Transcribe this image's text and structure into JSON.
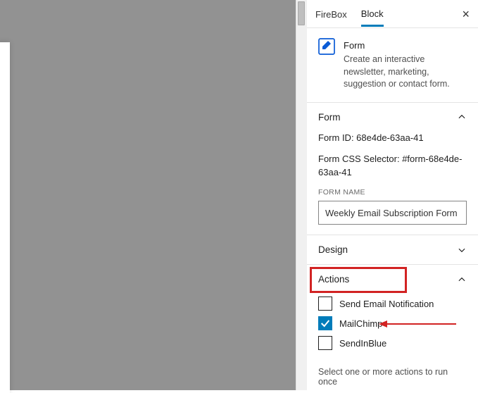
{
  "tabs": {
    "firebox": "FireBox",
    "block": "Block"
  },
  "block_card": {
    "title": "Form",
    "description": "Create an interactive newsletter, marketing, suggestion or contact form."
  },
  "form": {
    "header": "Form",
    "id_label": "Form ID: 68e4de-63aa-41",
    "selector_label": "Form CSS Selector: #form-68e4de-63aa-41",
    "name_field_label": "FORM NAME",
    "name_value": "Weekly Email Subscription Form"
  },
  "design": {
    "header": "Design"
  },
  "actions": {
    "header": "Actions",
    "items": [
      {
        "label": "Send Email Notification",
        "checked": false
      },
      {
        "label": "MailChimp",
        "checked": true
      },
      {
        "label": "SendInBlue",
        "checked": false
      }
    ],
    "helper": "Select one or more actions to run once"
  }
}
